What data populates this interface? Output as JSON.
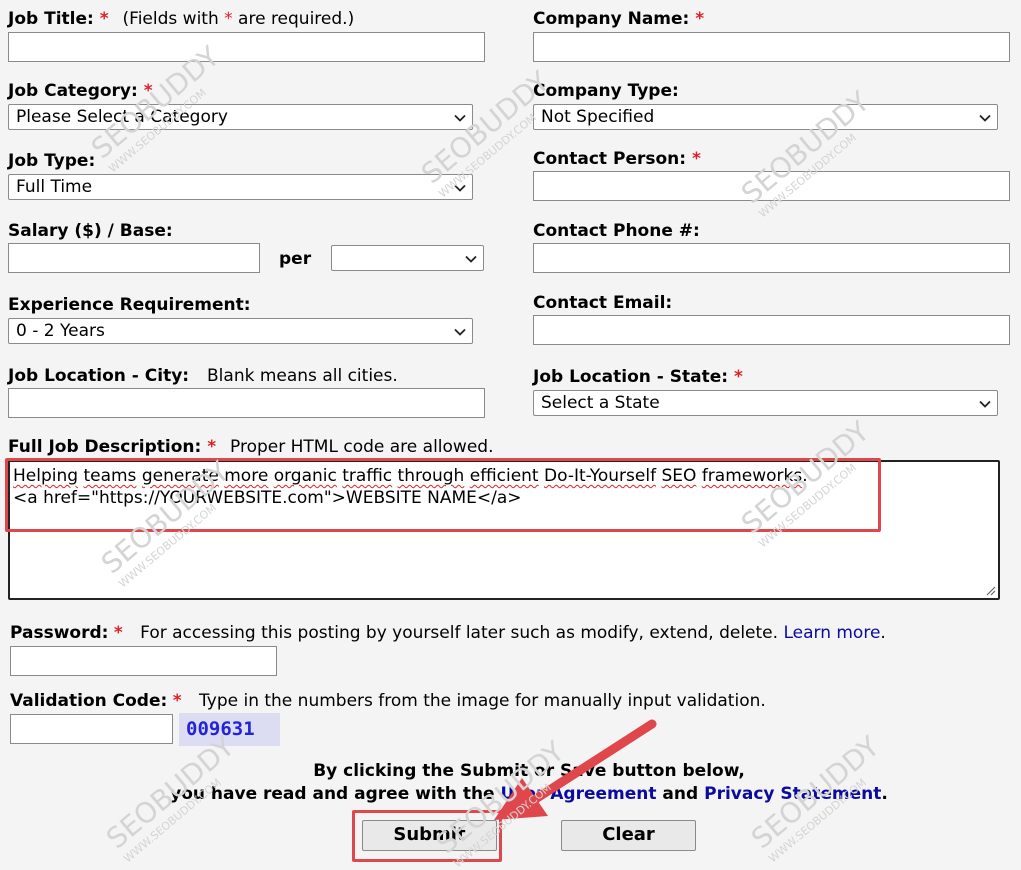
{
  "form": {
    "job_title": {
      "label": "Job Title:",
      "req": "*",
      "note_pre": "(Fields with ",
      "note_req": "*",
      "note_post": " are required.)"
    },
    "company_name": {
      "label": "Company Name:",
      "req": "*"
    },
    "job_category": {
      "label": "Job Category:",
      "req": "*",
      "value": "Please Select a Category"
    },
    "company_type": {
      "label": "Company Type:",
      "value": "Not Specified"
    },
    "job_type": {
      "label": "Job Type:",
      "value": "Full Time"
    },
    "contact_person": {
      "label": "Contact Person:",
      "req": "*"
    },
    "salary": {
      "label": "Salary ($) / Base:",
      "per": "per"
    },
    "contact_phone": {
      "label": "Contact Phone #:"
    },
    "experience": {
      "label": "Experience Requirement:",
      "value": "0 - 2 Years"
    },
    "contact_email": {
      "label": "Contact Email:"
    },
    "job_city": {
      "label": "Job Location - City:",
      "note": "Blank means all cities."
    },
    "job_state": {
      "label": "Job Location - State:",
      "req": "*",
      "value": "Select a State"
    },
    "description": {
      "label": "Full Job Description:",
      "req": "*",
      "note": "Proper HTML code are allowed.",
      "line1_words": [
        "Helping",
        "teams",
        "generate",
        "more",
        "organic",
        "traffic",
        "through",
        "efficient",
        "Do-It-Yourself",
        "SEO",
        "frameworks"
      ],
      "line1_end": ".",
      "line2": "<a href=\"https://YOURWEBSITE.com\">WEBSITE NAME</a>"
    },
    "password": {
      "label": "Password:",
      "req": "*",
      "note": "For accessing this posting by yourself later such as modify, extend, delete.",
      "link": "Learn more",
      "end": "."
    },
    "validation": {
      "label": "Validation Code:",
      "req": "*",
      "note": "Type in the numbers from the image for manually input validation.",
      "captcha": "009631"
    }
  },
  "agreement": {
    "line1": "By clicking the Submit or Save button below,",
    "line2_pre": "you have read and agree with the ",
    "user_agreement": "User Agreement",
    "and": " and ",
    "privacy": "Privacy Statement",
    "end": "."
  },
  "buttons": {
    "submit": "Submit",
    "clear": "Clear"
  },
  "watermark": {
    "brand": "SEOBUDDY",
    "site": "WWW.SEOBUDDY.COM"
  },
  "colors": {
    "required": "#e01f26",
    "link": "#0b0b9f",
    "highlight": "#e0474c",
    "captcha_bg": "#dcdcf2",
    "captcha_text": "#2323d8"
  }
}
